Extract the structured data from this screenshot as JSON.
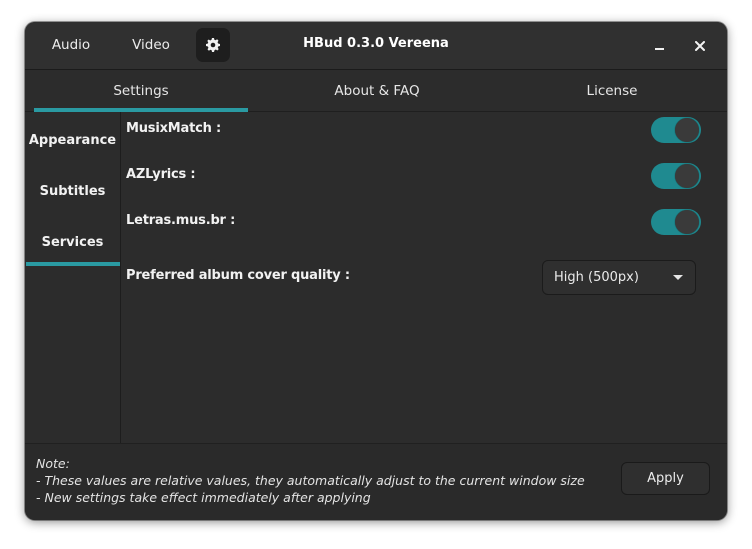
{
  "headerbar": {
    "audio_label": "Audio",
    "video_label": "Video",
    "settings_icon": "gear-icon",
    "title": "HBud 0.3.0 Vereena",
    "minimize_icon": "minimize-icon",
    "close_icon": "close-icon"
  },
  "tabs": [
    {
      "label": "Settings",
      "active": true
    },
    {
      "label": "About & FAQ",
      "active": false
    },
    {
      "label": "License",
      "active": false
    }
  ],
  "sidebar": {
    "items": [
      {
        "label": "Appearance",
        "active": false
      },
      {
        "label": "Subtitles",
        "active": false
      },
      {
        "label": "Services",
        "active": true
      }
    ]
  },
  "services": {
    "musixmatch": {
      "label": "MusixMatch :",
      "enabled": true
    },
    "azlyrics": {
      "label": "AZLyrics :",
      "enabled": true
    },
    "letras": {
      "label": "Letras.mus.br :",
      "enabled": true
    },
    "cover_quality": {
      "label": "Preferred album cover quality :",
      "selected": "High (500px)"
    }
  },
  "footer": {
    "note_title": "Note:",
    "note_line_1": "- These values are relative values, they automatically adjust to the current window size",
    "note_line_2": "- New settings take effect immediately after applying",
    "apply_label": "Apply"
  },
  "colors": {
    "accent": "#2a9aa2",
    "switch_on": "#1f8a90",
    "window_bg": "#2c2c2c"
  }
}
